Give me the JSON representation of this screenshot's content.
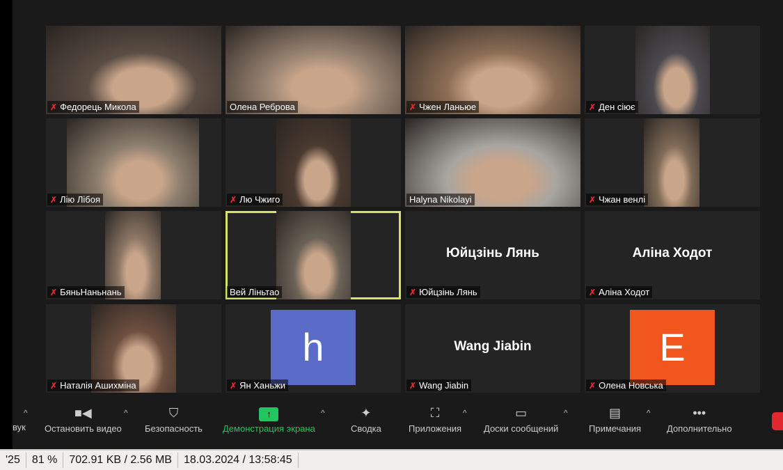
{
  "participants": [
    {
      "name": "Федорець Микола",
      "video": true,
      "muted": true,
      "bg": "#5a4d44"
    },
    {
      "name": "Олена Реброва",
      "video": true,
      "muted": false,
      "bg": "#9b8573"
    },
    {
      "name": "Чжен Ланьюе",
      "video": true,
      "muted": true,
      "bg": "#8c6e55"
    },
    {
      "name": "Ден сіює",
      "video": true,
      "muted": true,
      "bg": "#4c4a4f"
    },
    {
      "name": "Лію Лібоя",
      "video": true,
      "muted": true,
      "bg": "#8e7f6f"
    },
    {
      "name": "Лю Чжиго",
      "video": true,
      "muted": true,
      "bg": "#4a3a30"
    },
    {
      "name": "Halyna Nikolayi",
      "video": true,
      "muted": false,
      "bg": "#a9a5a0"
    },
    {
      "name": "Чжан венлі",
      "video": true,
      "muted": true,
      "bg": "#7f6b58"
    },
    {
      "name": "БяньНаньнань",
      "video": true,
      "muted": true,
      "bg": "#8d7766"
    },
    {
      "name": "Вей Ліньтао",
      "video": true,
      "muted": false,
      "active": true,
      "bg": "#6b6257"
    },
    {
      "name": "Юйцзінь Лянь",
      "video": false,
      "muted": true
    },
    {
      "name": "Аліна Ходот",
      "video": false,
      "muted": true
    },
    {
      "name": "Наталія Ашихміна",
      "video": true,
      "muted": true,
      "bg": "#6e5040"
    },
    {
      "name": "Ян Ханьжи",
      "avatar": "h",
      "avatar_color": "#5b6bc8",
      "muted": true
    },
    {
      "name": "Wang Jiabin",
      "video": false,
      "muted": true
    },
    {
      "name": "Олена Новська",
      "avatar": "E",
      "avatar_color": "#f0561d",
      "muted": true
    }
  ],
  "toolbar": {
    "audio": "вук",
    "video": "Остановить видео",
    "security": "Безопасность",
    "share": "Демонстрация экрана",
    "summary": "Сводка",
    "apps": "Приложения",
    "boards": "Доски сообщений",
    "notes": "Примечания",
    "more": "Дополнительно"
  },
  "status": {
    "page": "'25",
    "zoom": "81 %",
    "size": "702.91 KB / 2.56 MB",
    "datetime": "18.03.2024 / 13:58:45"
  }
}
